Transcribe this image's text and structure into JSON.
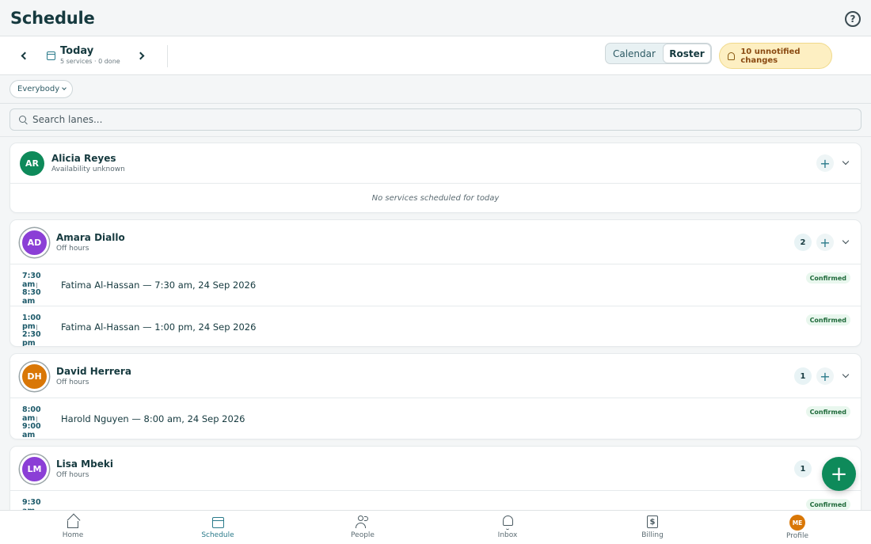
{
  "header": {
    "title": "Schedule",
    "help_icon": "help-circle-icon"
  },
  "toolbar": {
    "date_label": "Today",
    "date_sub": "5 services · 0 done",
    "view_toggle": [
      {
        "label": "Calendar",
        "active": false
      },
      {
        "label": "Roster",
        "active": true
      }
    ],
    "changes_label": "10 unnotified changes"
  },
  "filter": {
    "chip_label": "Everybody"
  },
  "search": {
    "placeholder": "Search lanes..."
  },
  "lanes": [
    {
      "initials": "AR",
      "name": "Alicia Reyes",
      "status": "Availability unknown",
      "color": "#0e8a5a",
      "count": null,
      "empty_message": "No services scheduled for today",
      "services": []
    },
    {
      "initials": "AD",
      "name": "Amara Diallo",
      "status": "Off hours",
      "color": "#8b3fd6",
      "count": "2",
      "services": [
        {
          "start": "7:30 am",
          "end": "8:30 am",
          "title": "Fatima Al-Hassan — 7:30 am, 24 Sep 2026",
          "status": "Confirmed"
        },
        {
          "start": "1:00 pm",
          "end": "2:30 pm",
          "title": "Fatima Al-Hassan — 1:00 pm, 24 Sep 2026",
          "status": "Confirmed"
        }
      ]
    },
    {
      "initials": "DH",
      "name": "David Herrera",
      "status": "Off hours",
      "color": "#d97706",
      "count": "1",
      "services": [
        {
          "start": "8:00 am",
          "end": "9:00 am",
          "title": "Harold Nguyen — 8:00 am, 24 Sep 2026",
          "status": "Confirmed"
        }
      ]
    },
    {
      "initials": "LM",
      "name": "Lisa Mbeki",
      "status": "Off hours",
      "color": "#8b3fd6",
      "count": "1",
      "services": [
        {
          "start": "9:30 am",
          "end": "",
          "title": "",
          "status": "Confirmed"
        }
      ]
    }
  ],
  "fab_icon": "plus-icon",
  "bottom_nav": [
    {
      "label": "Home",
      "icon": "home-icon",
      "active": false
    },
    {
      "label": "Schedule",
      "icon": "calendar-icon",
      "active": true
    },
    {
      "label": "People",
      "icon": "people-icon",
      "active": false
    },
    {
      "label": "Inbox",
      "icon": "bell-icon",
      "active": false
    },
    {
      "label": "Billing",
      "icon": "billing-icon",
      "active": false
    },
    {
      "label": "Profile",
      "icon": "avatar",
      "active": false,
      "initials": "ME"
    }
  ]
}
